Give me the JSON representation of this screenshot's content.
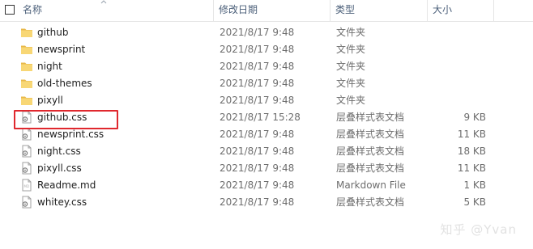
{
  "header": {
    "name": "名称",
    "date": "修改日期",
    "type": "类型",
    "size": "大小"
  },
  "files": [
    {
      "name": "github",
      "date": "2021/8/17 9:48",
      "type": "文件夹",
      "size": "",
      "kind": "folder"
    },
    {
      "name": "newsprint",
      "date": "2021/8/17 9:48",
      "type": "文件夹",
      "size": "",
      "kind": "folder"
    },
    {
      "name": "night",
      "date": "2021/8/17 9:48",
      "type": "文件夹",
      "size": "",
      "kind": "folder"
    },
    {
      "name": "old-themes",
      "date": "2021/8/17 9:48",
      "type": "文件夹",
      "size": "",
      "kind": "folder"
    },
    {
      "name": "pixyll",
      "date": "2021/8/17 9:48",
      "type": "文件夹",
      "size": "",
      "kind": "folder"
    },
    {
      "name": "github.css",
      "date": "2021/8/17 15:28",
      "type": "层叠样式表文档",
      "size": "9 KB",
      "kind": "css"
    },
    {
      "name": "newsprint.css",
      "date": "2021/8/17 9:48",
      "type": "层叠样式表文档",
      "size": "11 KB",
      "kind": "css"
    },
    {
      "name": "night.css",
      "date": "2021/8/17 9:48",
      "type": "层叠样式表文档",
      "size": "18 KB",
      "kind": "css"
    },
    {
      "name": "pixyll.css",
      "date": "2021/8/17 9:48",
      "type": "层叠样式表文档",
      "size": "11 KB",
      "kind": "css"
    },
    {
      "name": "Readme.md",
      "date": "2021/8/17 9:48",
      "type": "Markdown File",
      "size": "1 KB",
      "kind": "md"
    },
    {
      "name": "whitey.css",
      "date": "2021/8/17 9:48",
      "type": "层叠样式表文档",
      "size": "5 KB",
      "kind": "css"
    }
  ],
  "watermark": "知乎 @Yvan",
  "colors": {
    "folder": "#f8d775",
    "folder_dark": "#e8b84a",
    "highlight": "#e0282e",
    "header_text": "#4c607a"
  }
}
